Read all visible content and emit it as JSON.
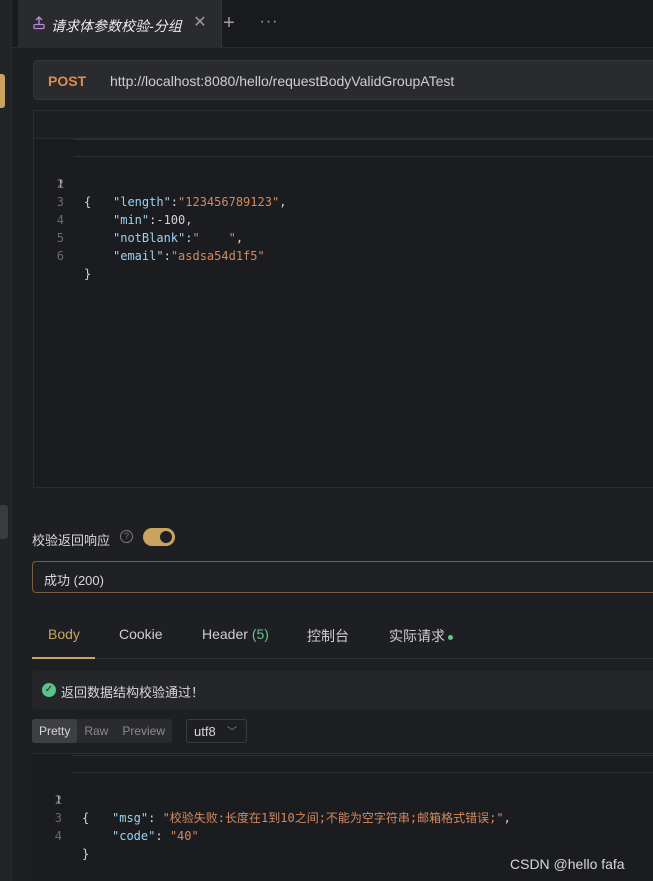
{
  "tab": {
    "title": "请求体参数校验-分组",
    "close": "✕",
    "add": "+",
    "more": "···"
  },
  "request": {
    "method": "POST",
    "url": "http://localhost:8080/hello/requestBodyValidGroupATest"
  },
  "request_body": {
    "line_numbers": [
      "1",
      "2",
      "3",
      "4",
      "5",
      "6"
    ],
    "open": "{",
    "close": "}",
    "fields": [
      {
        "key": "\"length\"",
        "sep": ":",
        "value": "\"123456789123\"",
        "tail": ","
      },
      {
        "key": "\"min\"",
        "sep": ":",
        "value": "-100",
        "tail": ","
      },
      {
        "key": "\"notBlank\"",
        "sep": ":",
        "value": "\"    \"",
        "tail": ","
      },
      {
        "key": "\"email\"",
        "sep": ":",
        "value": "\"asdsa54d1f5\"",
        "tail": ""
      }
    ]
  },
  "validate": {
    "label": "校验返回响应",
    "help": "?",
    "enabled": true
  },
  "status_select": {
    "value": "成功 (200)"
  },
  "response_tabs": {
    "body": "Body",
    "cookie": "Cookie",
    "header": "Header",
    "header_count": "(5)",
    "console": "控制台",
    "actual_request": "实际请求"
  },
  "notice": {
    "icon": "✓",
    "text": "返回数据结构校验通过！"
  },
  "format": {
    "pretty": "Pretty",
    "raw": "Raw",
    "preview": "Preview",
    "encoding": "utf8",
    "caret": "﹀"
  },
  "response_body": {
    "line_numbers": [
      "1",
      "2",
      "3",
      "4"
    ],
    "open": "{",
    "close": "}",
    "fields": [
      {
        "key": "\"msg\"",
        "sep": ": ",
        "value": "\"校验失败:长度在1到10之间;不能为空字符串;邮箱格式错误;\"",
        "tail": ","
      },
      {
        "key": "\"code\"",
        "sep": ": ",
        "value": "\"40\"",
        "tail": ""
      }
    ]
  },
  "watermark": "CSDN @hello fafa",
  "colors": {
    "accent": "#c9a461",
    "method": "#e08a4b",
    "success": "#5cc28a",
    "json_key": "#9cd2f2",
    "json_string": "#d48a61"
  }
}
